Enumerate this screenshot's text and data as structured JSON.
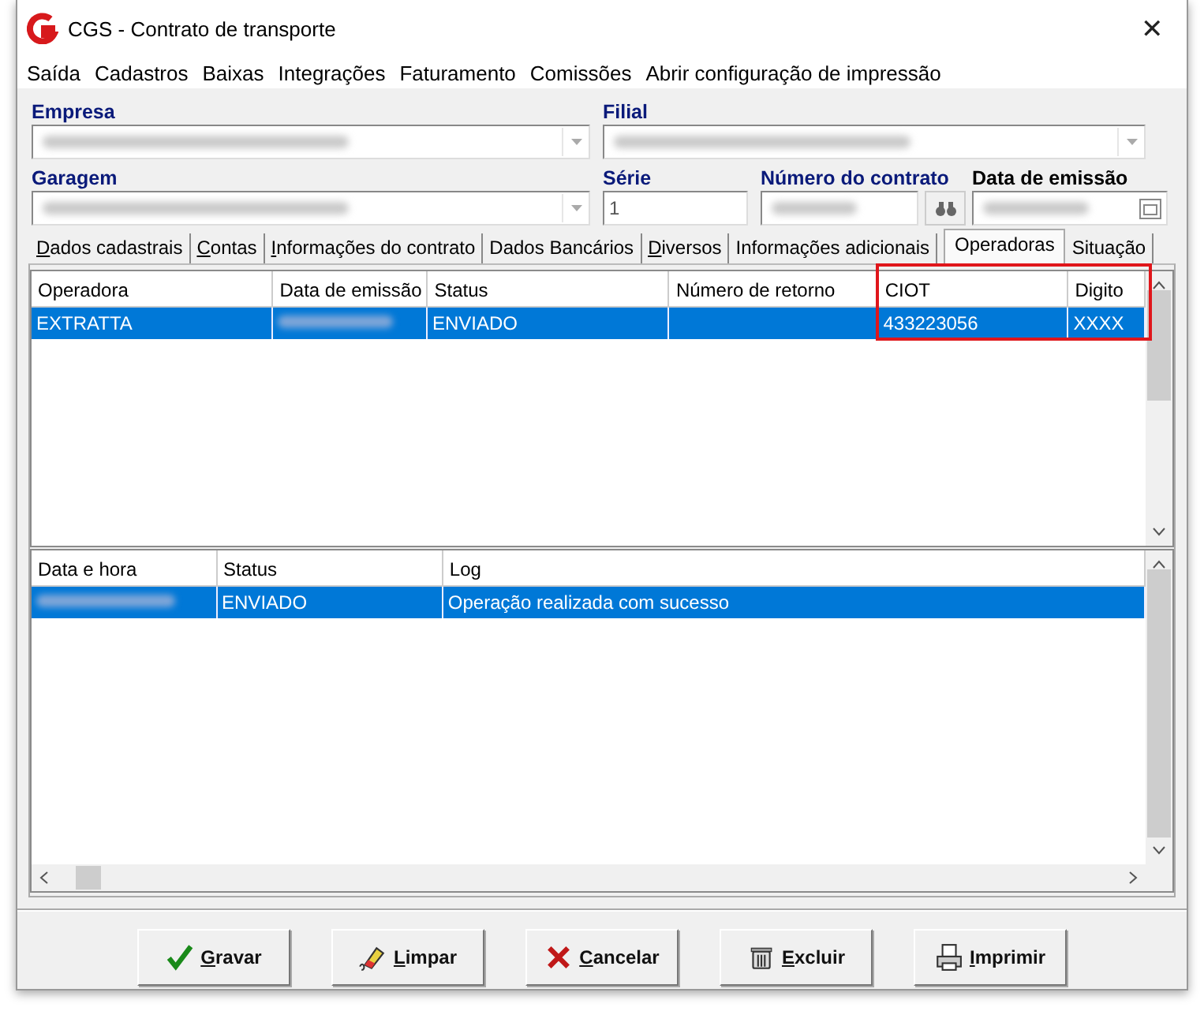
{
  "window": {
    "title": "CGS - Contrato de transporte",
    "close": "✕"
  },
  "menu": [
    {
      "label": "Saída"
    },
    {
      "label": "Cadastros"
    },
    {
      "label": "Baixas"
    },
    {
      "label": "Integrações"
    },
    {
      "label": "Faturamento"
    },
    {
      "label": "Comissões"
    },
    {
      "label": "Abrir configuração de impressão"
    }
  ],
  "fields": [
    {
      "label": "Empresa",
      "kind": "dropdown",
      "blurred": true
    },
    {
      "label": "Filial",
      "kind": "dropdown",
      "blurred": true
    },
    {
      "label": "Garagem",
      "kind": "dropdown",
      "blurred": true
    },
    {
      "label": "Série",
      "kind": "text",
      "value": "1"
    },
    {
      "label": "Número do contrato",
      "kind": "lookup",
      "blurred": true
    },
    {
      "label": "Data de emissão",
      "kind": "date",
      "blurred": true,
      "plain_label": true
    }
  ],
  "tabs": [
    {
      "label": "Dados cadastrais",
      "selected": false,
      "underline_first": true
    },
    {
      "label": "Contas",
      "selected": false,
      "underline_first": true
    },
    {
      "label": "Informações do contrato",
      "selected": false,
      "underline_first": true
    },
    {
      "label": "Dados Bancários",
      "selected": false,
      "underline_first": false
    },
    {
      "label": "Diversos",
      "selected": false,
      "underline_first": true
    },
    {
      "label": "Informações adicionais",
      "selected": false,
      "underline_first": false
    },
    {
      "label": "Operadoras",
      "selected": true,
      "underline_first": false
    },
    {
      "label": "Situação",
      "selected": false,
      "underline_first": false
    }
  ],
  "operators_table": {
    "columns": [
      {
        "label": "Operadora",
        "highlighted": false
      },
      {
        "label": "Data de emissão",
        "highlighted": false
      },
      {
        "label": "Status",
        "highlighted": false
      },
      {
        "label": "Número de retorno",
        "highlighted": false
      },
      {
        "label": "CIOT",
        "highlighted": true
      },
      {
        "label": "Digito",
        "highlighted": true
      }
    ],
    "rows": [
      {
        "selected": true,
        "cells": [
          {
            "text": "EXTRATTA"
          },
          {
            "blurred": true
          },
          {
            "text": "ENVIADO"
          },
          {
            "text": ""
          },
          {
            "text": "433223056"
          },
          {
            "text": "XXXX"
          }
        ]
      }
    ]
  },
  "log_table": {
    "columns": [
      {
        "label": "Data e hora",
        "highlighted": false
      },
      {
        "label": "Status",
        "highlighted": false
      },
      {
        "label": "Log",
        "highlighted": false
      }
    ],
    "rows": [
      {
        "selected": true,
        "cells": [
          {
            "blurred": true
          },
          {
            "text": "ENVIADO"
          },
          {
            "text": "Operação realizada com sucesso"
          }
        ]
      }
    ]
  },
  "buttons": [
    {
      "label": "Gravar"
    },
    {
      "label": "Limpar"
    },
    {
      "label": "Cancelar"
    },
    {
      "label": "Excluir"
    },
    {
      "label": "Imprimir"
    }
  ]
}
